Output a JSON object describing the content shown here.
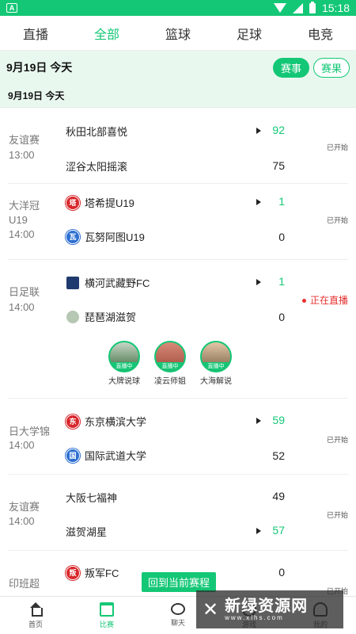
{
  "status_bar": {
    "time": "15:18",
    "app_icon": "A"
  },
  "tabs": [
    {
      "label": "直播",
      "active": false
    },
    {
      "label": "全部",
      "active": true
    },
    {
      "label": "篮球",
      "active": false
    },
    {
      "label": "足球",
      "active": false
    },
    {
      "label": "电竞",
      "active": false
    }
  ],
  "date_bar": {
    "date": "9月19日  今天",
    "btn_events": "赛事",
    "btn_results": "赛果"
  },
  "section_date": "9月19日  今天",
  "matches": [
    {
      "league": "友谊赛",
      "time": "13:00",
      "home": {
        "name": "秋田北部喜悦",
        "badge": ""
      },
      "away": {
        "name": "涩谷太阳摇滚",
        "badge": ""
      },
      "home_score": "92",
      "away_score": "75",
      "state": "已开始"
    },
    {
      "league": "大洋冠U19",
      "time": "14:00",
      "home": {
        "name": "塔希提U19",
        "badge": "塔"
      },
      "away": {
        "name": "瓦努阿图U19",
        "badge": "瓦"
      },
      "home_score": "1",
      "away_score": "0",
      "state": "已开始"
    },
    {
      "league": "日足联",
      "time": "14:00",
      "home": {
        "name": "横河武藏野FC",
        "badge": ""
      },
      "away": {
        "name": "琵琶湖滋贺",
        "badge": ""
      },
      "home_score": "1",
      "away_score": "0",
      "state": "正在直播"
    },
    {
      "league": "日大学锦",
      "time": "14:00",
      "home": {
        "name": "东京横滨大学",
        "badge": "东"
      },
      "away": {
        "name": "国际武道大学",
        "badge": "国"
      },
      "home_score": "59",
      "away_score": "52",
      "state": "已开始"
    },
    {
      "league": "友谊赛",
      "time": "14:00",
      "home": {
        "name": "大阪七福神",
        "badge": ""
      },
      "away": {
        "name": "滋贺湖星",
        "badge": ""
      },
      "home_score": "49",
      "away_score": "57",
      "state": "已开始"
    },
    {
      "league": "印班超",
      "time": "",
      "home": {
        "name": "叛军FC",
        "badge": "叛"
      },
      "away": {
        "name": "",
        "badge": ""
      },
      "home_score": "0",
      "away_score": "",
      "state": "已开始"
    }
  ],
  "streamers": [
    {
      "name": "大牌说球",
      "tag": "直播中"
    },
    {
      "name": "凌云师姐",
      "tag": "直播中"
    },
    {
      "name": "大海解说",
      "tag": "直播中"
    }
  ],
  "back_button": "回到当前赛程",
  "bottom_nav": [
    {
      "label": "首页",
      "icon": "home-icon"
    },
    {
      "label": "比赛",
      "icon": "calendar-icon"
    },
    {
      "label": "聊天",
      "icon": "chat-icon"
    },
    {
      "label": "游戏",
      "icon": "ball-icon"
    },
    {
      "label": "我的",
      "icon": "user-icon"
    }
  ],
  "watermark": {
    "title": "新绿资源网",
    "url": "www.xlhs.com"
  },
  "colors": {
    "accent": "#14c776",
    "live": "#e63030"
  }
}
